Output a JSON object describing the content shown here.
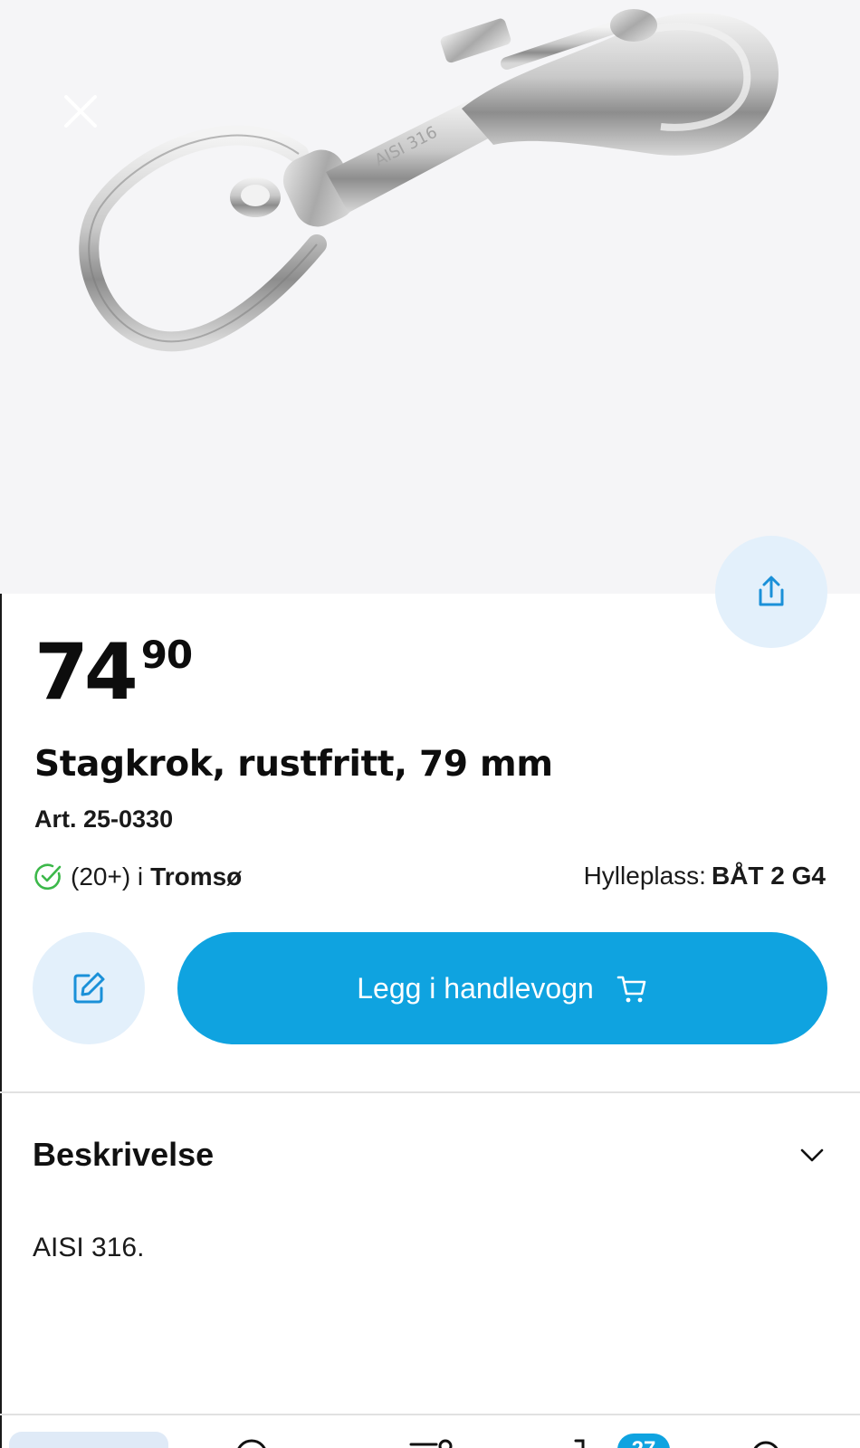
{
  "colors": {
    "accent": "#0fa3e0",
    "accent_light": "#e3f0fb",
    "stock_green": "#3cb84a",
    "image_bg": "#f5f5f7"
  },
  "header": {
    "close_icon": "close-icon",
    "share_icon": "share-icon",
    "image_engraving": "AISI 316"
  },
  "product": {
    "price_main": "74",
    "price_cents": "90",
    "title": "Stagkrok, rustfritt, 79 mm",
    "article": "Art. 25-0330",
    "stock_count": "(20+) i",
    "stock_location": "Tromsø",
    "shelf_label": "Hylleplass:",
    "shelf_value": "BÅT 2 G4"
  },
  "actions": {
    "edit_icon": "edit-icon",
    "add_to_cart_label": "Legg i handlevogn",
    "cart_icon": "cart-icon"
  },
  "description": {
    "title": "Beskrivelse",
    "expanded": true,
    "text": "AISI 316."
  },
  "bottom_nav": {
    "badge": "27"
  }
}
